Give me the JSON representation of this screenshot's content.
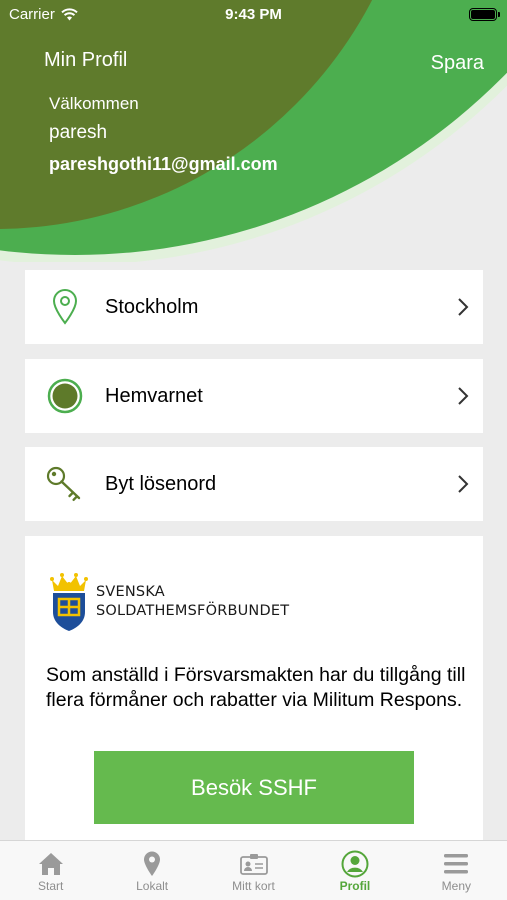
{
  "status_bar": {
    "carrier": "Carrier",
    "time": "9:43 PM"
  },
  "header": {
    "title": "Min Profil",
    "save_label": "Spara",
    "welcome": "Välkommen",
    "username": "paresh",
    "email": "pareshgothi11@gmail.com"
  },
  "menu": [
    {
      "label": "Stockholm",
      "icon": "location-pin-icon"
    },
    {
      "label": "Hemvarnet",
      "icon": "unit-circle-icon"
    },
    {
      "label": "Byt lösenord",
      "icon": "key-icon"
    }
  ],
  "promo": {
    "logo_line1": "SVENSKA",
    "logo_line2": "SOLDATHEMSFÖRBUNDET",
    "description": "Som anställd i Försvarsmakten har du tillgång till flera förmåner och rabatter via Militum Respons.",
    "button_label": "Besök SSHF"
  },
  "tabs": [
    {
      "label": "Start",
      "icon": "home-icon",
      "active": false
    },
    {
      "label": "Lokalt",
      "icon": "location-icon",
      "active": false
    },
    {
      "label": "Mitt kort",
      "icon": "id-card-icon",
      "active": false
    },
    {
      "label": "Profil",
      "icon": "profile-icon",
      "active": true
    },
    {
      "label": "Meny",
      "icon": "menu-icon",
      "active": false
    }
  ],
  "colors": {
    "olive": "#5e7a2a",
    "green": "#4cae4f",
    "button_green": "#65ba4e",
    "active_tab": "#54a63a"
  }
}
